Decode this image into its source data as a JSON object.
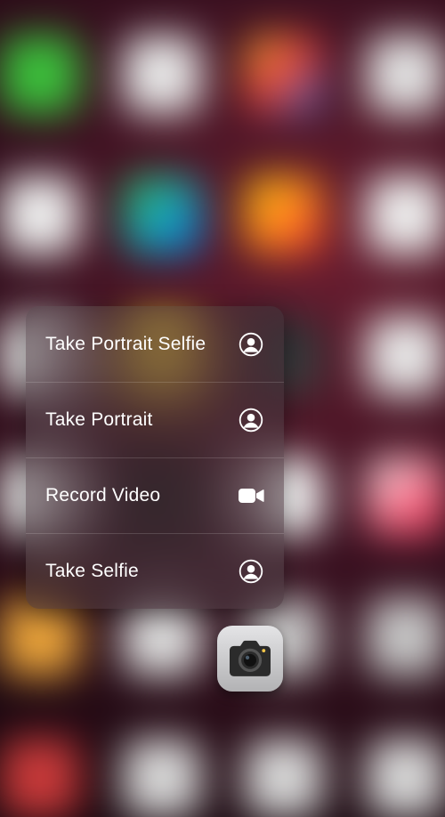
{
  "quick_actions": {
    "items": [
      {
        "label": "Take Portrait Selfie",
        "icon": "portrait"
      },
      {
        "label": "Take Portrait",
        "icon": "portrait"
      },
      {
        "label": "Record Video",
        "icon": "video"
      },
      {
        "label": "Take Selfie",
        "icon": "portrait"
      }
    ]
  },
  "target_app": {
    "name": "Camera"
  }
}
